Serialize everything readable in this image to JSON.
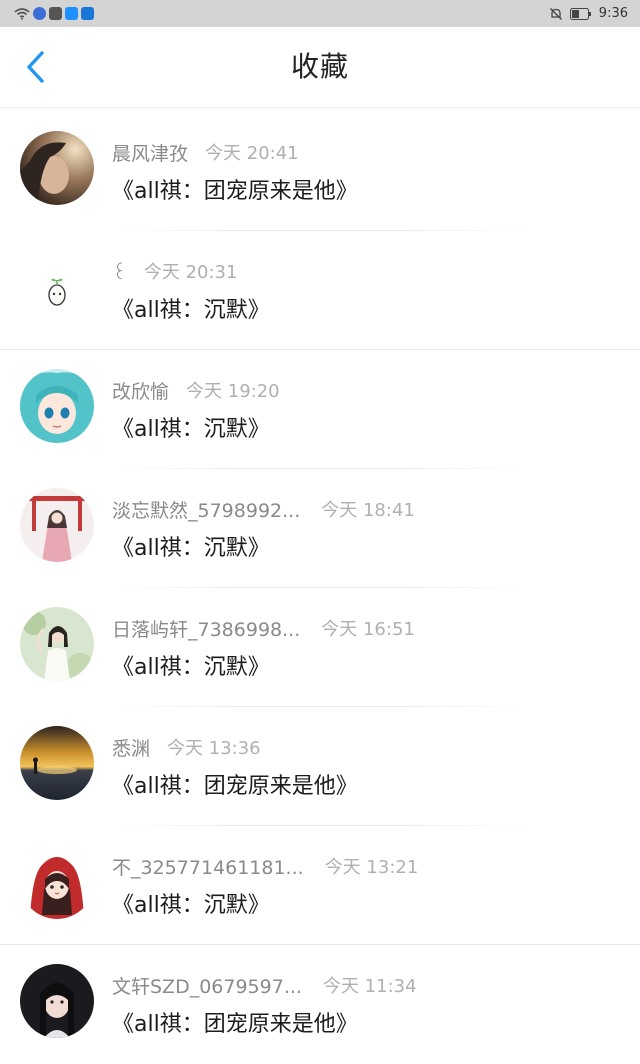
{
  "status_bar": {
    "time": "9:36",
    "icons": [
      "wifi-icon",
      "app-icon",
      "mail-icon",
      "search-app-icon",
      "cloud-app-icon"
    ],
    "right_icons": [
      "mute-bell-icon",
      "battery-icon"
    ]
  },
  "header": {
    "title": "收藏",
    "back_icon": "chevron-left-icon",
    "accent_color": "#2196f3"
  },
  "favorites": [
    {
      "name": "晨风津孜",
      "time": "今天 20:41",
      "story": "《all祺：团宠原来是他》"
    },
    {
      "name": "꒰",
      "time": "今天 20:31",
      "story": "《all祺：沉默》"
    },
    {
      "name": "改欣愉",
      "time": "今天 19:20",
      "story": "《all祺：沉默》"
    },
    {
      "name": "淡忘默然_5798992...",
      "time": "今天 18:41",
      "story": "《all祺：沉默》"
    },
    {
      "name": "日落屿轩_7386998...",
      "time": "今天 16:51",
      "story": "《all祺：沉默》"
    },
    {
      "name": "悉渊",
      "time": "今天 13:36",
      "story": "《all祺：团宠原来是他》"
    },
    {
      "name": "不_325771461181...",
      "time": "今天 13:21",
      "story": "《all祺：沉默》"
    },
    {
      "name": "文轩SZD_0679597...",
      "time": "今天 11:34",
      "story": "《all祺：团宠原来是他》"
    }
  ]
}
